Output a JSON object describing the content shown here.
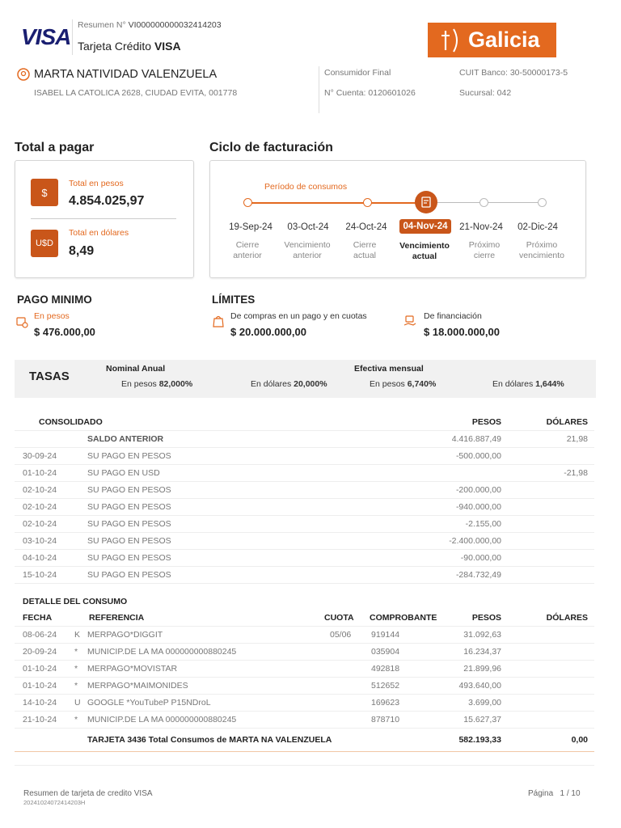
{
  "header": {
    "visa_logo": "VISA",
    "resumen_label": "Resumen N°",
    "resumen_num": "VI000000000032414203",
    "card_prefix": "Tarjeta Crédito",
    "card_brand": "VISA",
    "bank_logo": "Galicia",
    "holder": "MARTA NATIVIDAD VALENZUELA",
    "address": "ISABEL LA CATOLICA 2628, CIUDAD EVITA, 001778",
    "consumidor": "Consumidor Final",
    "cuenta": "N° Cuenta: 0120601026",
    "cuit": "CUIT Banco: 30-50000173-5",
    "sucursal": "Sucursal: 042"
  },
  "total": {
    "title": "Total a pagar",
    "pesos_label": "Total en pesos",
    "pesos_value": "4.854.025,97",
    "pesos_icon": "$",
    "dolares_label": "Total en dólares",
    "dolares_value": "8,49",
    "dolares_icon": "U$D"
  },
  "ciclo": {
    "title": "Ciclo de facturación",
    "period_label": "Período de consumos",
    "steps": [
      {
        "date": "19-Sep-24",
        "label1": "Cierre",
        "label2": "anterior"
      },
      {
        "date": "03-Oct-24",
        "label1": "Vencimiento",
        "label2": "anterior"
      },
      {
        "date": "24-Oct-24",
        "label1": "Cierre",
        "label2": "actual"
      },
      {
        "date": "04-Nov-24",
        "label1": "Vencimiento",
        "label2": "actual"
      },
      {
        "date": "21-Nov-24",
        "label1": "Próximo",
        "label2": "cierre"
      },
      {
        "date": "02-Dic-24",
        "label1": "Próximo",
        "label2": "vencimiento"
      }
    ]
  },
  "pago_minimo": {
    "title": "PAGO MINIMO",
    "label": "En pesos",
    "value": "$ 476.000,00"
  },
  "limites": {
    "title": "LÍMITES",
    "compras_label": "De compras en un pago y en cuotas",
    "compras_value": "$ 20.000.000,00",
    "financiacion_label": "De financiación",
    "financiacion_value": "$ 18.000.000,00"
  },
  "tasas": {
    "title": "TASAS",
    "nominal_title": "Nominal Anual",
    "efectiva_title": "Efectiva mensual",
    "nominal_pesos_label": "En pesos",
    "nominal_pesos": "82,000%",
    "nominal_dolares_label": "En dólares",
    "nominal_dolares": "20,000%",
    "efectiva_pesos_label": "En pesos",
    "efectiva_pesos": "6,740%",
    "efectiva_dolares_label": "En dólares",
    "efectiva_dolares": "1,644%"
  },
  "consolidado": {
    "title": "CONSOLIDADO",
    "col_pesos": "PESOS",
    "col_dolares": "DÓLARES",
    "rows": [
      {
        "fecha": "",
        "desc": "SALDO ANTERIOR",
        "pesos": "4.416.887,49",
        "dolares": "21,98"
      },
      {
        "fecha": "30-09-24",
        "desc": "SU PAGO EN PESOS",
        "pesos": "-500.000,00",
        "dolares": ""
      },
      {
        "fecha": "01-10-24",
        "desc": "SU PAGO EN USD",
        "pesos": "",
        "dolares": "-21,98"
      },
      {
        "fecha": "02-10-24",
        "desc": "SU PAGO EN PESOS",
        "pesos": "-200.000,00",
        "dolares": ""
      },
      {
        "fecha": "02-10-24",
        "desc": "SU PAGO EN PESOS",
        "pesos": "-940.000,00",
        "dolares": ""
      },
      {
        "fecha": "02-10-24",
        "desc": "SU PAGO EN PESOS",
        "pesos": "-2.155,00",
        "dolares": ""
      },
      {
        "fecha": "03-10-24",
        "desc": "SU PAGO EN PESOS",
        "pesos": "-2.400.000,00",
        "dolares": ""
      },
      {
        "fecha": "04-10-24",
        "desc": "SU PAGO EN PESOS",
        "pesos": "-90.000,00",
        "dolares": ""
      },
      {
        "fecha": "15-10-24",
        "desc": "SU PAGO EN PESOS",
        "pesos": "-284.732,49",
        "dolares": ""
      }
    ]
  },
  "detalle": {
    "title": "DETALLE DEL CONSUMO",
    "col_fecha": "FECHA",
    "col_ref": "REFERENCIA",
    "col_cuota": "CUOTA",
    "col_comp": "COMPROBANTE",
    "col_pesos": "PESOS",
    "col_dolares": "DÓLARES",
    "rows": [
      {
        "fecha": "08-06-24",
        "mark": "K",
        "ref": "MERPAGO*DIGGIT",
        "cuota": "05/06",
        "comp": "919144",
        "pesos": "31.092,63",
        "dolares": ""
      },
      {
        "fecha": "20-09-24",
        "mark": "*",
        "ref": "MUNICIP.DE LA MA 000000000880245",
        "cuota": "",
        "comp": "035904",
        "pesos": "16.234,37",
        "dolares": ""
      },
      {
        "fecha": "01-10-24",
        "mark": "*",
        "ref": "MERPAGO*MOVISTAR",
        "cuota": "",
        "comp": "492818",
        "pesos": "21.899,96",
        "dolares": ""
      },
      {
        "fecha": "01-10-24",
        "mark": "*",
        "ref": "MERPAGO*MAIMONIDES",
        "cuota": "",
        "comp": "512652",
        "pesos": "493.640,00",
        "dolares": ""
      },
      {
        "fecha": "14-10-24",
        "mark": "U",
        "ref": "GOOGLE *YouTubeP P15NDroL",
        "cuota": "",
        "comp": "169623",
        "pesos": "3.699,00",
        "dolares": ""
      },
      {
        "fecha": "21-10-24",
        "mark": "*",
        "ref": "MUNICIP.DE LA MA 000000000880245",
        "cuota": "",
        "comp": "878710",
        "pesos": "15.627,37",
        "dolares": ""
      }
    ],
    "total_label": "TARJETA 3436 Total Consumos de MARTA NA VALENZUELA",
    "total_pesos": "582.193,33",
    "total_dolares": "0,00"
  },
  "footer": {
    "left": "Resumen de tarjeta de credito VISA",
    "code": "20241024072414203H",
    "page_label": "Página",
    "page": "1 / 10"
  },
  "colors": {
    "accent": "#e3691f",
    "icon_bg": "#c9561a",
    "visa_blue": "#1a1f71"
  }
}
